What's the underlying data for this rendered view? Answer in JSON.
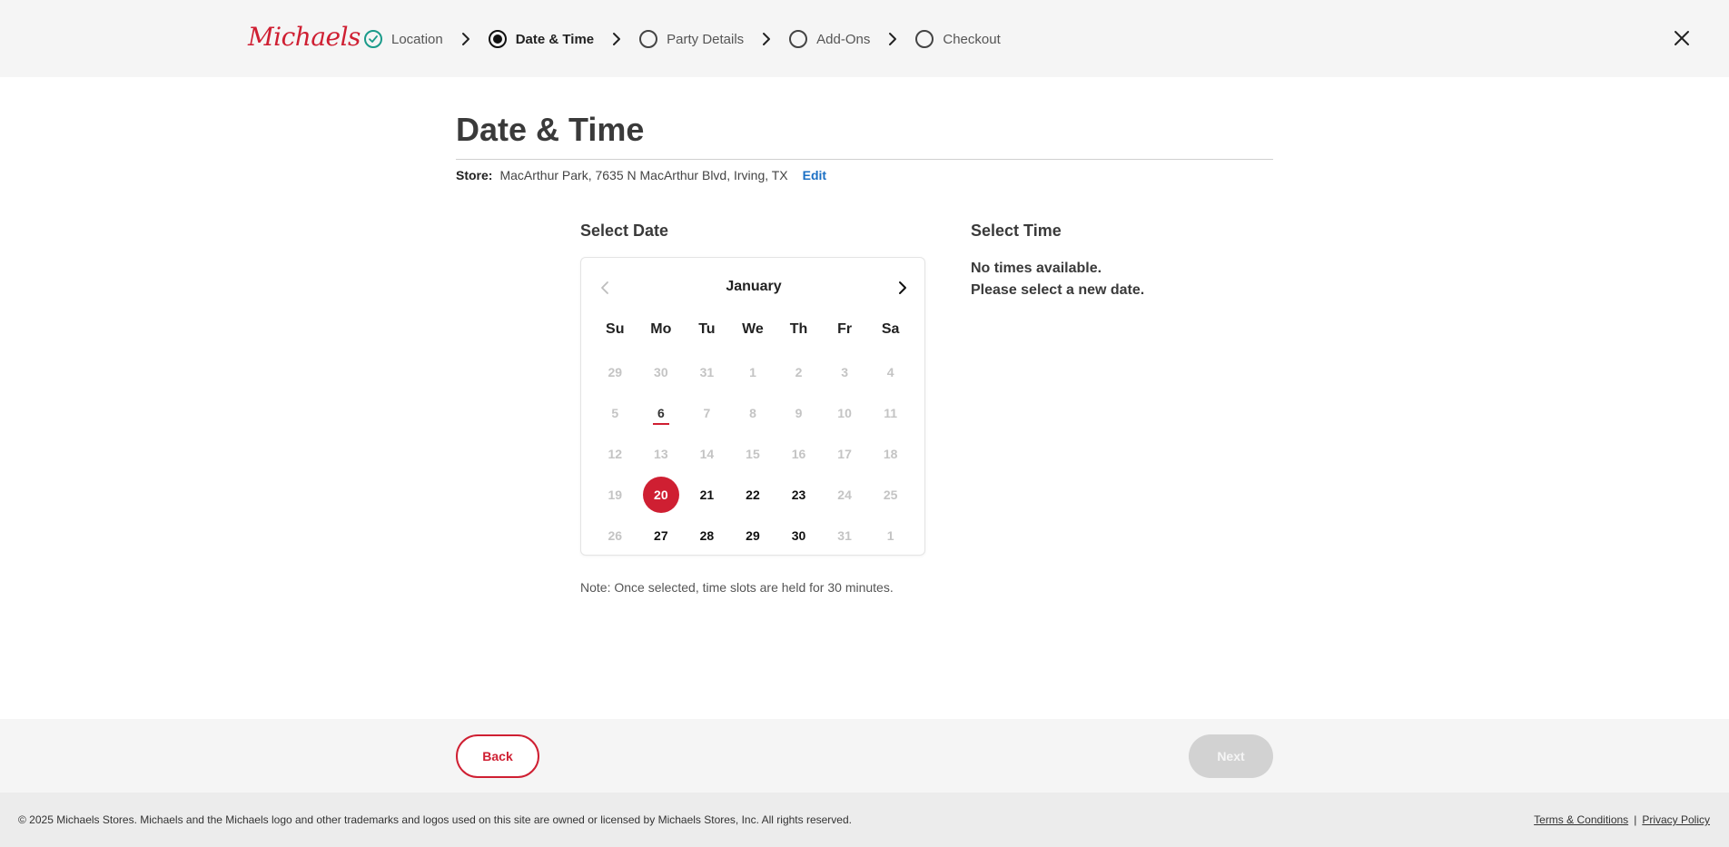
{
  "header": {
    "logo": "Michaels",
    "steps": [
      {
        "label": "Location",
        "state": "done"
      },
      {
        "label": "Date & Time",
        "state": "active"
      },
      {
        "label": "Party Details",
        "state": "todo"
      },
      {
        "label": "Add-Ons",
        "state": "todo"
      },
      {
        "label": "Checkout",
        "state": "todo"
      }
    ],
    "close_icon": "close-icon"
  },
  "main": {
    "title": "Date & Time",
    "store_label": "Store:",
    "store_value": "MacArthur Park, 7635 N MacArthur Blvd, Irving, TX",
    "edit_label": "Edit",
    "select_date_title": "Select Date",
    "select_time_title": "Select Time",
    "no_times_line1": "No times available.",
    "no_times_line2": "Please select a new date.",
    "note": "Note: Once selected, time slots are held for 30 minutes."
  },
  "calendar": {
    "month": "January",
    "dows": [
      "Su",
      "Mo",
      "Tu",
      "We",
      "Th",
      "Fr",
      "Sa"
    ],
    "weeks": [
      [
        {
          "d": "29",
          "s": "disabled"
        },
        {
          "d": "30",
          "s": "disabled"
        },
        {
          "d": "31",
          "s": "disabled"
        },
        {
          "d": "1",
          "s": "disabled"
        },
        {
          "d": "2",
          "s": "disabled"
        },
        {
          "d": "3",
          "s": "disabled"
        },
        {
          "d": "4",
          "s": "disabled"
        }
      ],
      [
        {
          "d": "5",
          "s": "disabled"
        },
        {
          "d": "6",
          "s": "today"
        },
        {
          "d": "7",
          "s": "disabled"
        },
        {
          "d": "8",
          "s": "disabled"
        },
        {
          "d": "9",
          "s": "disabled"
        },
        {
          "d": "10",
          "s": "disabled"
        },
        {
          "d": "11",
          "s": "disabled"
        }
      ],
      [
        {
          "d": "12",
          "s": "disabled"
        },
        {
          "d": "13",
          "s": "disabled"
        },
        {
          "d": "14",
          "s": "disabled"
        },
        {
          "d": "15",
          "s": "disabled"
        },
        {
          "d": "16",
          "s": "disabled"
        },
        {
          "d": "17",
          "s": "disabled"
        },
        {
          "d": "18",
          "s": "disabled"
        }
      ],
      [
        {
          "d": "19",
          "s": "disabled"
        },
        {
          "d": "20",
          "s": "selected"
        },
        {
          "d": "21",
          "s": "available"
        },
        {
          "d": "22",
          "s": "available"
        },
        {
          "d": "23",
          "s": "available"
        },
        {
          "d": "24",
          "s": "disabled"
        },
        {
          "d": "25",
          "s": "disabled"
        }
      ],
      [
        {
          "d": "26",
          "s": "disabled"
        },
        {
          "d": "27",
          "s": "available"
        },
        {
          "d": "28",
          "s": "available"
        },
        {
          "d": "29",
          "s": "available"
        },
        {
          "d": "30",
          "s": "available"
        },
        {
          "d": "31",
          "s": "disabled"
        },
        {
          "d": "1",
          "s": "disabled"
        }
      ]
    ]
  },
  "actions": {
    "back_label": "Back",
    "next_label": "Next"
  },
  "footer": {
    "copyright": "© 2025 Michaels Stores. Michaels and the Michaels logo and other trademarks and logos used on this site are owned or licensed by Michaels Stores, Inc. All rights reserved.",
    "terms": "Terms & Conditions",
    "separator": "|",
    "privacy": "Privacy Policy"
  },
  "colors": {
    "brand_red": "#cf1f32",
    "done_teal": "#1a9b8a",
    "link_blue": "#1a6fc4"
  }
}
